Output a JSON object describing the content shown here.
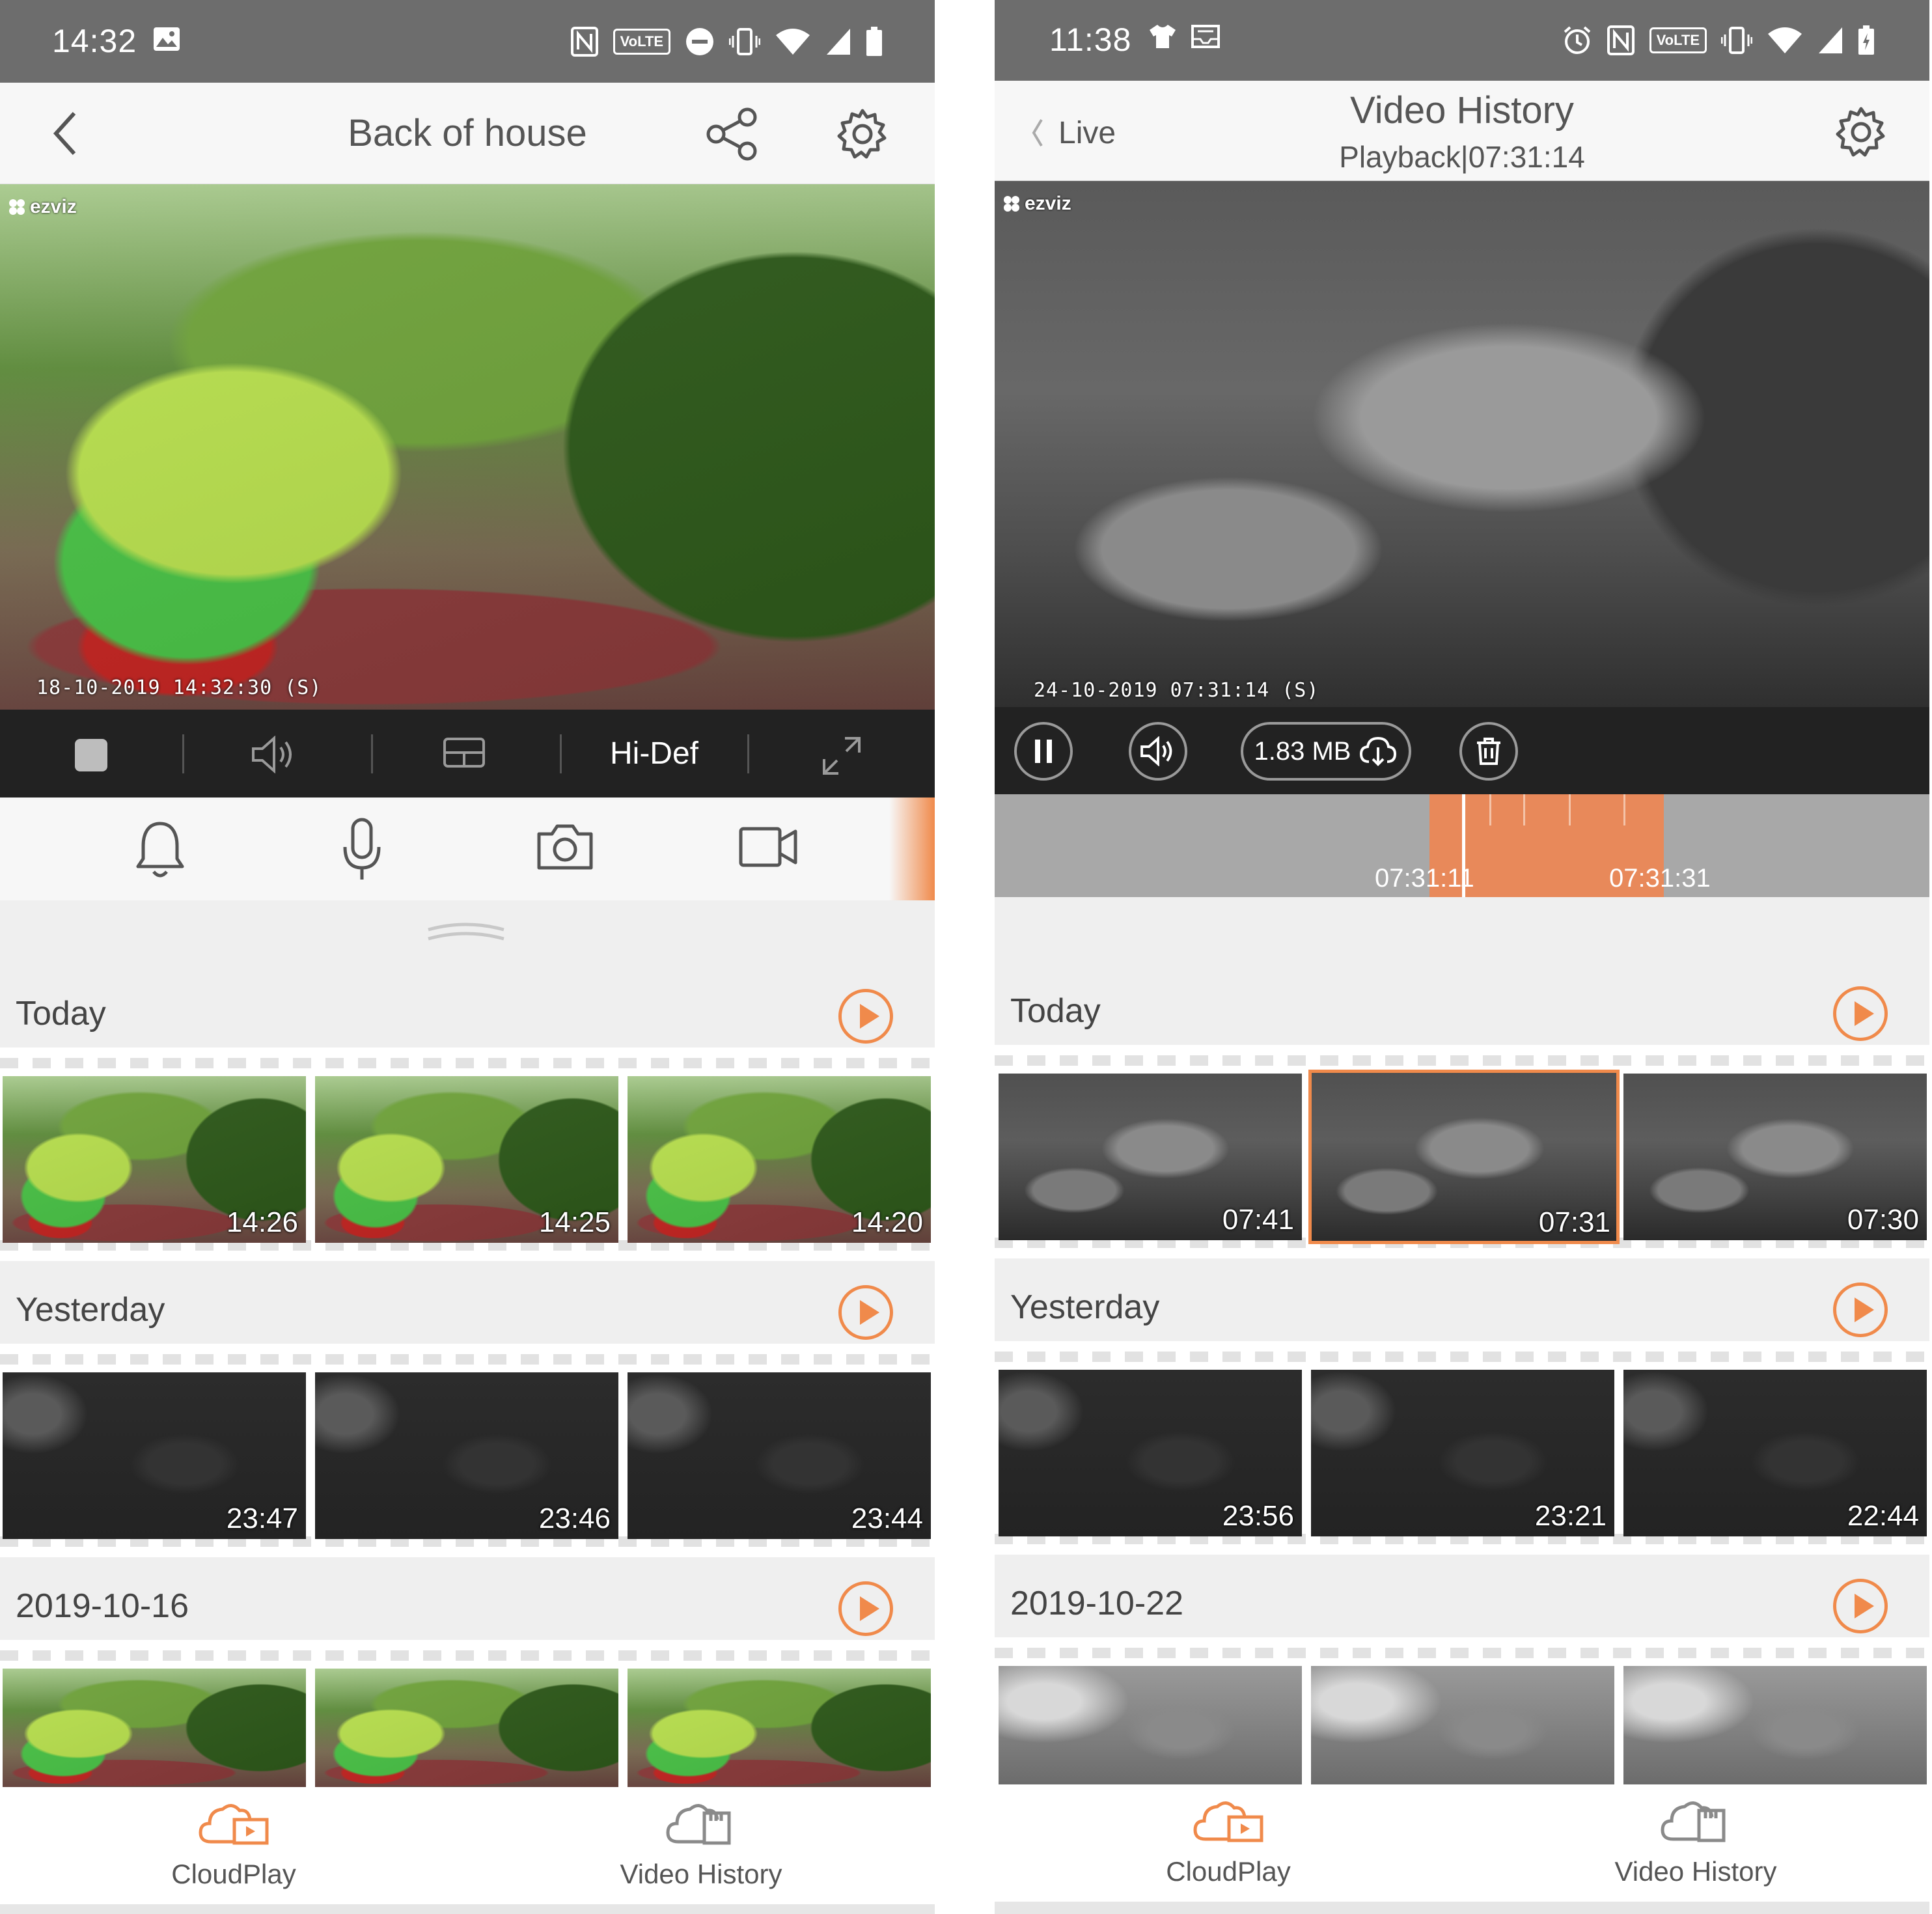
{
  "left": {
    "status": {
      "time": "14:32",
      "volte": "VoLTE"
    },
    "header": {
      "title": "Back of house"
    },
    "video": {
      "brand": "ezviz",
      "osd": "18-10-2019 14:32:30   (S)"
    },
    "controls": {
      "quality_label": "Hi-Def"
    },
    "sections": [
      {
        "label": "Today",
        "thumbs": [
          "14:26",
          "14:25",
          "14:20"
        ]
      },
      {
        "label": "Yesterday",
        "thumbs": [
          "23:47",
          "23:46",
          "23:44"
        ]
      },
      {
        "label": "2019-10-16",
        "thumbs": [
          "",
          "",
          ""
        ]
      }
    ],
    "nav": {
      "cloudplay": "CloudPlay",
      "history": "Video History"
    }
  },
  "right": {
    "status": {
      "time": "11:38",
      "volte": "VoLTE"
    },
    "header": {
      "back_label": "Live",
      "title": "Video History",
      "subtitle": "Playback|07:31:14"
    },
    "video": {
      "brand": "ezviz",
      "osd": "24-10-2019 07:31:14   (S)"
    },
    "controls": {
      "download_size": "1.83 MB"
    },
    "timeline": {
      "label_start": "07:31:11",
      "label_end": "07:31:31"
    },
    "sections": [
      {
        "label": "Today",
        "thumbs": [
          "07:41",
          "07:31",
          "07:30"
        ]
      },
      {
        "label": "Yesterday",
        "thumbs": [
          "23:56",
          "23:21",
          "22:44"
        ]
      },
      {
        "label": "2019-10-22",
        "thumbs": [
          "",
          "",
          ""
        ]
      }
    ],
    "nav": {
      "cloudplay": "CloudPlay",
      "history": "Video History"
    }
  },
  "colors": {
    "accent": "#f08a4b",
    "status_bar": "#6d6d6d",
    "control_bar": "#222222"
  }
}
